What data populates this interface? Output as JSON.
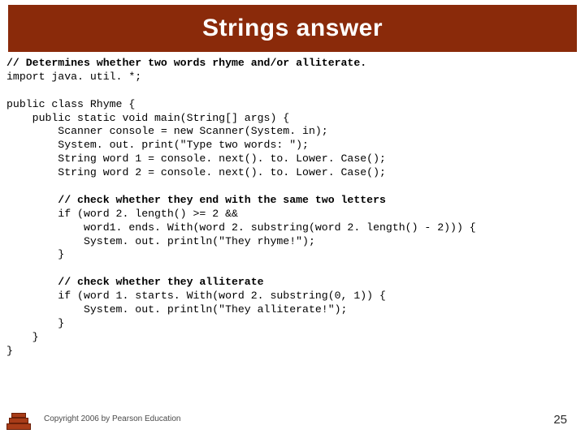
{
  "title": "Strings answer",
  "code": {
    "c01": "// Determines whether two words rhyme and/or alliterate.",
    "l02": "import java. util. *;",
    "l03": "",
    "l04": "public class Rhyme {",
    "l05": "    public static void main(String[] args) {",
    "l06": "        Scanner console = new Scanner(System. in);",
    "l07": "        System. out. print(\"Type two words: \");",
    "l08": "        String word 1 = console. next(). to. Lower. Case();",
    "l09": "        String word 2 = console. next(). to. Lower. Case();",
    "l10": "",
    "c11": "        // check whether they end with the same two letters",
    "l12": "        if (word 2. length() >= 2 &&",
    "l13": "            word1. ends. With(word 2. substring(word 2. length() - 2))) {",
    "l14": "            System. out. println(\"They rhyme!\");",
    "l15": "        }",
    "l16": "",
    "c17": "        // check whether they alliterate",
    "l18": "        if (word 1. starts. With(word 2. substring(0, 1)) {",
    "l19": "            System. out. println(\"They alliterate!\");",
    "l20": "        }",
    "l21": "    }",
    "l22": "}"
  },
  "footer": "Copyright 2006 by Pearson Education",
  "page": "25"
}
